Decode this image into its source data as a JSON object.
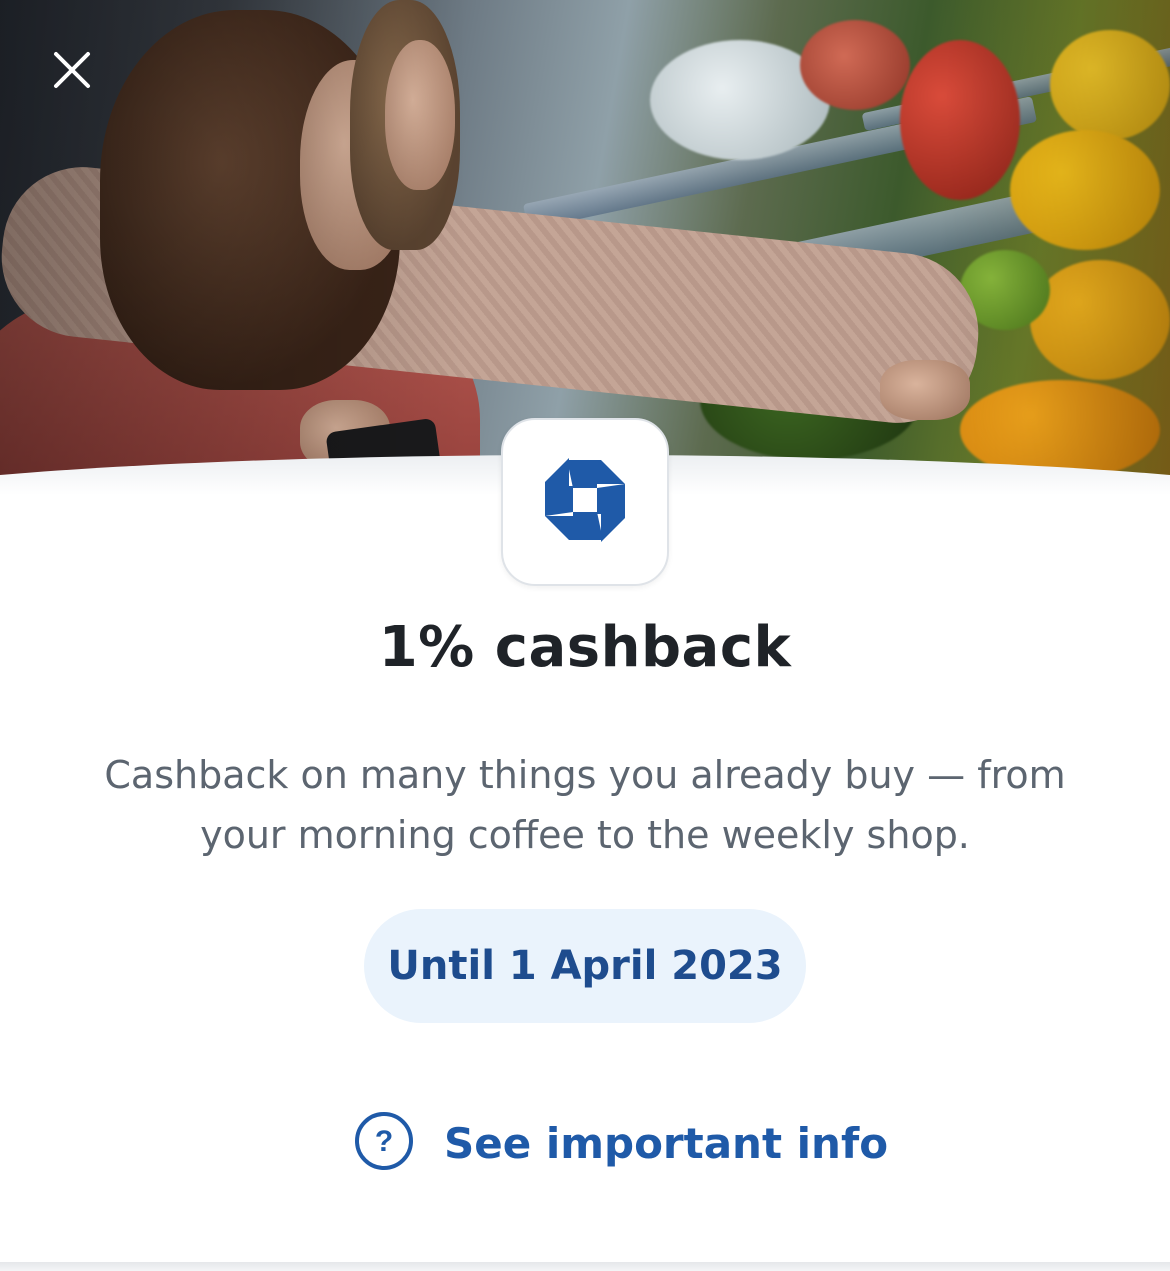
{
  "offer": {
    "title": "1% cashback",
    "description": "Cashback on many things you already buy — from your morning coffee to the weekly shop.",
    "validity": "Until 1 April 2023"
  },
  "links": {
    "info_label": "See important info"
  },
  "icons": {
    "close": "close-icon",
    "brand": "chase-octagon-logo",
    "help": "question-circle-icon"
  },
  "colors": {
    "brand_blue": "#1f5aa8",
    "title_text": "#1f2328",
    "body_text": "#5c6570",
    "pill_bg": "#eaf3fc",
    "pill_text": "#1e4c8e"
  }
}
